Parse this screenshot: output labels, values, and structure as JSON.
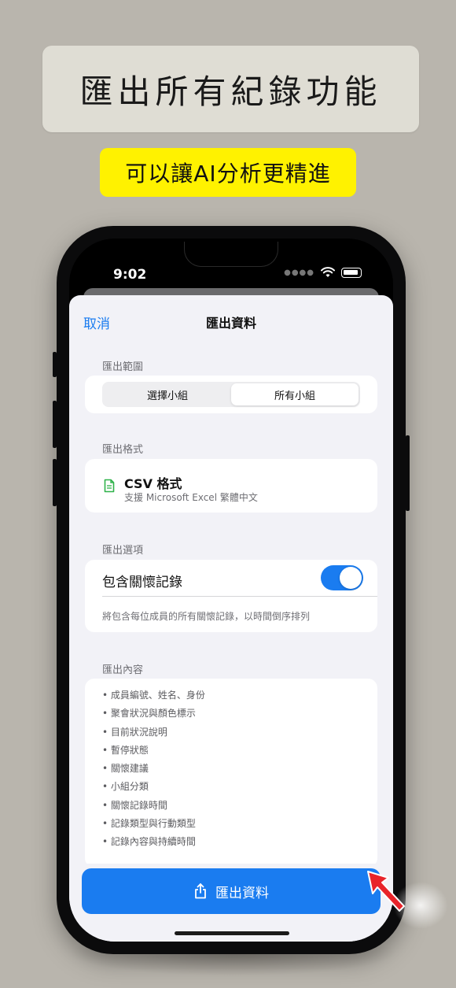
{
  "promo": {
    "title": "匯出所有紀錄功能",
    "subtitle": "可以讓AI分析更精進"
  },
  "status_bar": {
    "time": "9:02"
  },
  "nav": {
    "cancel": "取消",
    "title": "匯出資料"
  },
  "range": {
    "label": "匯出範圍",
    "options": [
      "選擇小組",
      "所有小組"
    ],
    "selected": "所有小組"
  },
  "format": {
    "label": "匯出格式",
    "icon": "document-icon",
    "name": "CSV 格式",
    "description": "支援 Microsoft Excel 繁體中文"
  },
  "options": {
    "label": "匯出選項",
    "include_care_records": "包含關懷記錄",
    "include_care_records_on": true,
    "note": "將包含每位成員的所有關懷記錄，以時間倒序排列"
  },
  "content": {
    "label": "匯出內容",
    "items": [
      "• 成員編號、姓名、身份",
      "• 聚會狀況與顏色標示",
      "• 目前狀況說明",
      "• 暫停狀態",
      "• 關懷建議",
      "• 小組分類",
      "• 關懷記錄時間",
      "• 記錄類型與行動類型",
      "• 記錄內容與持續時間"
    ]
  },
  "export_button": {
    "label": "匯出資料",
    "icon": "share-icon"
  },
  "colors": {
    "accent": "#1a7cf0",
    "highlight": "#fff200",
    "arrow": "#e8242a"
  }
}
